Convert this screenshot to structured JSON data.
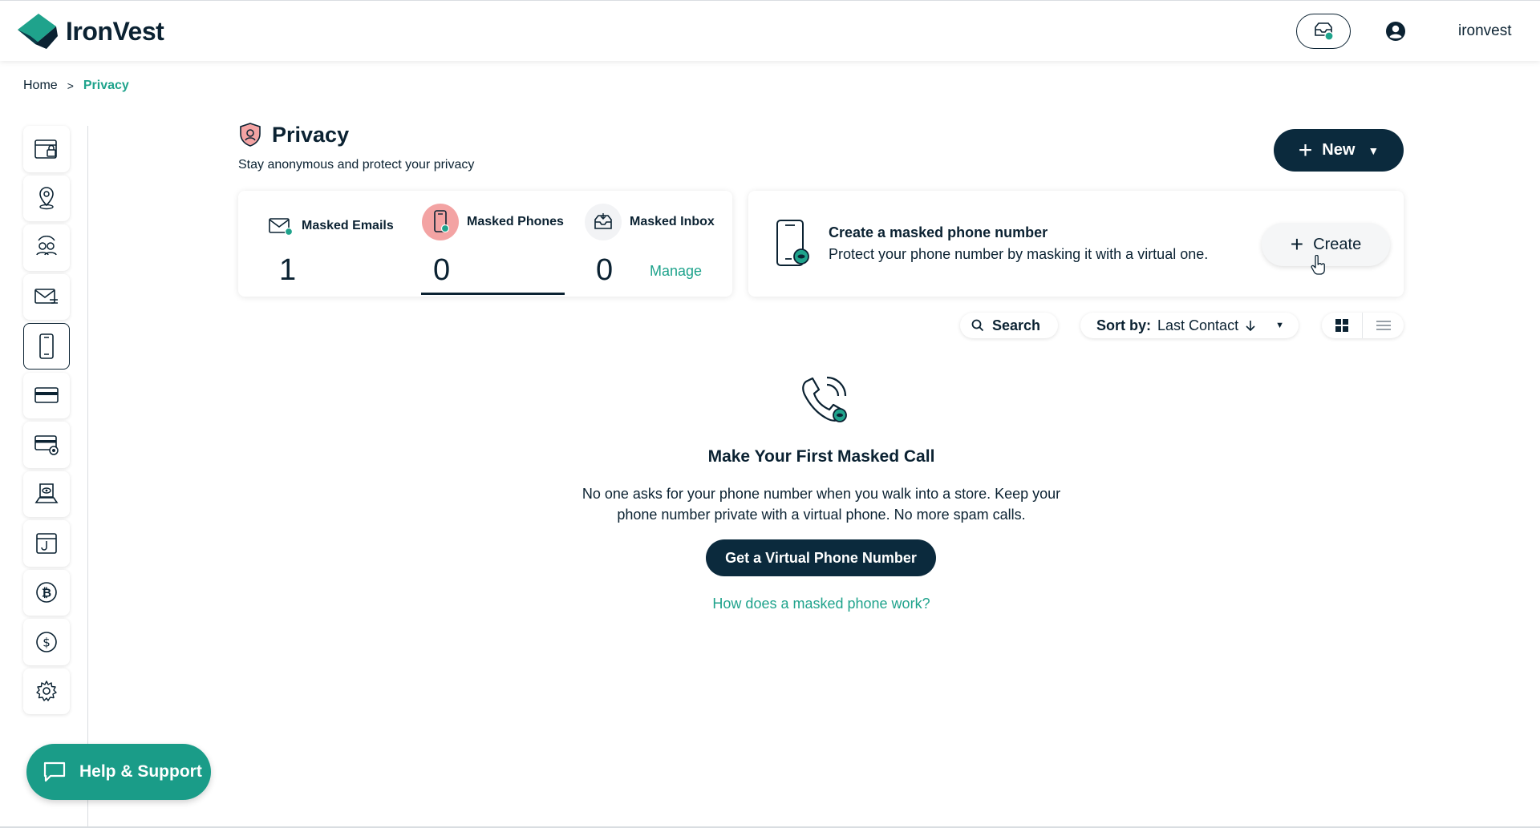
{
  "header": {
    "logo_text": "IronVest",
    "username": "ironvest"
  },
  "breadcrumb": {
    "home": "Home",
    "separator": ">",
    "current": "Privacy"
  },
  "sidebar": {
    "items": [
      {
        "icon": "wallet-lock-icon"
      },
      {
        "icon": "location-pin-icon"
      },
      {
        "icon": "identity-sync-icon"
      },
      {
        "icon": "email-icon"
      },
      {
        "icon": "phone-icon",
        "active": true
      },
      {
        "icon": "credit-card-icon"
      },
      {
        "icon": "masked-card-icon"
      },
      {
        "icon": "laptop-eye-icon"
      },
      {
        "icon": "browser-hook-icon"
      },
      {
        "icon": "bitcoin-icon"
      },
      {
        "icon": "dollar-icon"
      },
      {
        "icon": "gear-icon"
      }
    ],
    "help_label": "Help & Support"
  },
  "page": {
    "title": "Privacy",
    "subtitle": "Stay anonymous and protect your privacy",
    "new_button": "New"
  },
  "stats": {
    "masked_emails": {
      "label": "Masked Emails",
      "value": "1"
    },
    "masked_phones": {
      "label": "Masked Phones",
      "value": "0"
    },
    "masked_inbox": {
      "label": "Masked Inbox",
      "value": "0"
    },
    "manage_label": "Manage"
  },
  "create_card": {
    "title": "Create a masked phone number",
    "description": "Protect your phone number by masking it with a virtual one.",
    "button": "Create"
  },
  "toolbar": {
    "search_label": "Search",
    "sort_prefix": "Sort by:",
    "sort_value": "Last Contact"
  },
  "empty_state": {
    "title": "Make Your First Masked Call",
    "description": "No one asks for your phone number when you walk into a store. Keep your phone number private with a virtual phone. No more spam calls.",
    "cta": "Get a Virtual Phone Number",
    "help_link": "How does a masked phone work?"
  },
  "colors": {
    "primary_dark": "#0b2a3d",
    "accent_green": "#1fa38c",
    "help_green": "#1a9c88",
    "phone_highlight": "#f3a3a3"
  }
}
